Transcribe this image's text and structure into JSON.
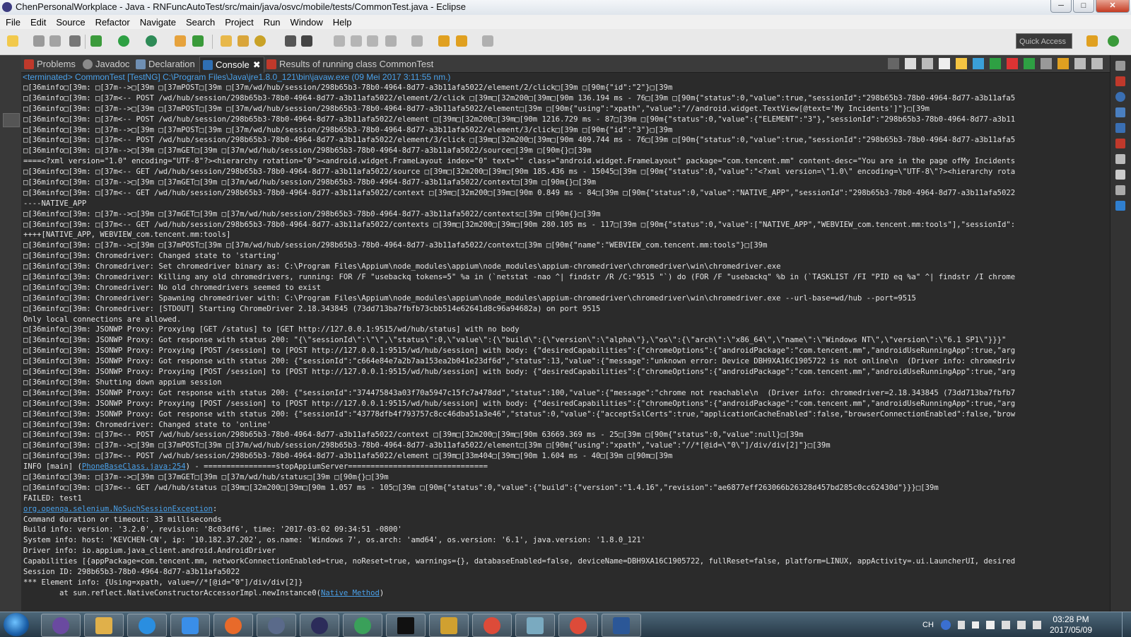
{
  "window": {
    "title": "ChenPersonalWorkplace - Java - RNFuncAutoTest/src/main/java/osvc/mobile/tests/CommonTest.java - Eclipse",
    "controls": [
      "─",
      "□",
      "✕"
    ]
  },
  "menu": [
    "File",
    "Edit",
    "Source",
    "Refactor",
    "Navigate",
    "Search",
    "Project",
    "Run",
    "Window",
    "Help"
  ],
  "toolbar": {
    "quick_access_placeholder": "Quick Access"
  },
  "tabs": [
    {
      "label": "Problems",
      "icon": "problems-icon"
    },
    {
      "label": "Javadoc",
      "icon": "javadoc-icon"
    },
    {
      "label": "Declaration",
      "icon": "declaration-icon"
    },
    {
      "label": "Console",
      "icon": "console-icon",
      "active": true
    },
    {
      "label": "Results of running class CommonTest",
      "icon": "testng-icon"
    }
  ],
  "console": {
    "status": "<terminated> CommonTest [TestNG] C:\\Program Files\\Java\\jre1.8.0_121\\bin\\javaw.exe (09 Mei 2017 3:11:55 nm.)",
    "lines": [
      {
        "text": "□[36minfo□[39m: □[37m-->□[39m □[37mPOST□[39m □[37m/wd/hub/session/298b65b3-78b0-4964-8d77-a3b11afa5022/element/2/click□[39m □[90m{\"id\":\"2\"}□[39m"
      },
      {
        "text": "□[36minfo□[39m: □[37m<-- POST /wd/hub/session/298b65b3-78b0-4964-8d77-a3b11afa5022/element/2/click □[39m□[32m200□[39m□[90m 136.194 ms - 76□[39m □[90m{\"status\":0,\"value\":true,\"sessionId\":\"298b65b3-78b0-4964-8d77-a3b11afa5"
      },
      {
        "text": "□[36minfo□[39m: □[37m-->□[39m □[37mPOST□[39m □[37m/wd/hub/session/298b65b3-78b0-4964-8d77-a3b11afa5022/element□[39m □[90m{\"using\":\"xpath\",\"value\":\"//android.widget.TextView[@text='My Incidents']\"}□[39m"
      },
      {
        "text": "□[36minfo□[39m: □[37m<-- POST /wd/hub/session/298b65b3-78b0-4964-8d77-a3b11afa5022/element □[39m□[32m200□[39m□[90m 1216.729 ms - 87□[39m □[90m{\"status\":0,\"value\":{\"ELEMENT\":\"3\"},\"sessionId\":\"298b65b3-78b0-4964-8d77-a3b11"
      },
      {
        "text": "□[36minfo□[39m: □[37m-->□[39m □[37mPOST□[39m □[37m/wd/hub/session/298b65b3-78b0-4964-8d77-a3b11afa5022/element/3/click□[39m □[90m{\"id\":\"3\"}□[39m"
      },
      {
        "text": "□[36minfo□[39m: □[37m<-- POST /wd/hub/session/298b65b3-78b0-4964-8d77-a3b11afa5022/element/3/click □[39m□[32m200□[39m□[90m 409.744 ms - 76□[39m □[90m{\"status\":0,\"value\":true,\"sessionId\":\"298b65b3-78b0-4964-8d77-a3b11afa5"
      },
      {
        "text": "□[36minfo□[39m: □[37m-->□[39m □[37mGET□[39m □[37m/wd/hub/session/298b65b3-78b0-4964-8d77-a3b11afa5022/source□[39m □[90m{}□[39m"
      },
      {
        "text": "====<?xml version=\"1.0\" encoding=\"UTF-8\"?><hierarchy rotation=\"0\"><android.widget.FrameLayout index=\"0\" text=\"\" class=\"android.widget.FrameLayout\" package=\"com.tencent.mm\" content-desc=\"You are in the page ofMy Incidents"
      },
      {
        "text": "□[36minfo□[39m: □[37m<-- GET /wd/hub/session/298b65b3-78b0-4964-8d77-a3b11afa5022/source □[39m□[32m200□[39m□[90m 185.436 ms - 15045□[39m □[90m{\"status\":0,\"value\":\"<?xml version=\\\"1.0\\\" encoding=\\\"UTF-8\\\"?><hierarchy rota"
      },
      {
        "text": "□[36minfo□[39m: □[37m-->□[39m □[37mGET□[39m □[37m/wd/hub/session/298b65b3-78b0-4964-8d77-a3b11afa5022/context□[39m □[90m{}□[39m"
      },
      {
        "text": "□[36minfo□[39m: □[37m<-- GET /wd/hub/session/298b65b3-78b0-4964-8d77-a3b11afa5022/context □[39m□[32m200□[39m□[90m 0.849 ms - 84□[39m □[90m{\"status\":0,\"value\":\"NATIVE_APP\",\"sessionId\":\"298b65b3-78b0-4964-8d77-a3b11afa5022"
      },
      {
        "text": "----NATIVE_APP"
      },
      {
        "text": "□[36minfo□[39m: □[37m-->□[39m □[37mGET□[39m □[37m/wd/hub/session/298b65b3-78b0-4964-8d77-a3b11afa5022/contexts□[39m □[90m{}□[39m"
      },
      {
        "text": "□[36minfo□[39m: □[37m<-- GET /wd/hub/session/298b65b3-78b0-4964-8d77-a3b11afa5022/contexts □[39m□[32m200□[39m□[90m 280.105 ms - 117□[39m □[90m{\"status\":0,\"value\":[\"NATIVE_APP\",\"WEBVIEW_com.tencent.mm:tools\"],\"sessionId\":"
      },
      {
        "text": "++++[NATIVE_APP, WEBVIEW_com.tencent.mm:tools]"
      },
      {
        "text": "□[36minfo□[39m: □[37m-->□[39m □[37mPOST□[39m □[37m/wd/hub/session/298b65b3-78b0-4964-8d77-a3b11afa5022/context□[39m □[90m{\"name\":\"WEBVIEW_com.tencent.mm:tools\"}□[39m"
      },
      {
        "text": "□[36minfo□[39m: Chromedriver: Changed state to 'starting'"
      },
      {
        "text": "□[36minfo□[39m: Chromedriver: Set chromedriver binary as: C:\\Program Files\\Appium\\node_modules\\appium\\node_modules\\appium-chromedriver\\chromedriver\\win\\chromedriver.exe"
      },
      {
        "text": "□[36minfo□[39m: Chromedriver: Killing any old chromedrivers, running: FOR /F \"usebackq tokens=5\" %a in (`netstat -nao ^| findstr /R /C:\"9515 \"`) do (FOR /F \"usebackq\" %b in (`TASKLIST /FI \"PID eq %a\" ^| findstr /I chrome"
      },
      {
        "text": "□[36minfo□[39m: Chromedriver: No old chromedrivers seemed to exist"
      },
      {
        "text": "□[36minfo□[39m: Chromedriver: Spawning chromedriver with: C:\\Program Files\\Appium\\node_modules\\appium\\node_modules\\appium-chromedriver\\chromedriver\\win\\chromedriver.exe --url-base=wd/hub --port=9515"
      },
      {
        "text": "□[36minfo□[39m: Chromedriver: [STDOUT] Starting ChromeDriver 2.18.343845 (73dd713ba7fbfb73cbb514e62641d8c96a94682a) on port 9515"
      },
      {
        "text": "Only local connections are allowed."
      },
      {
        "text": "□[36minfo□[39m: JSONWP Proxy: Proxying [GET /status] to [GET http://127.0.0.1:9515/wd/hub/status] with no body"
      },
      {
        "text": "□[36minfo□[39m: JSONWP Proxy: Got response with status 200: \"{\\\"sessionId\\\":\\\"\\\",\\\"status\\\":0,\\\"value\\\":{\\\"build\\\":{\\\"version\\\":\\\"alpha\\\"},\\\"os\\\":{\\\"arch\\\":\\\"x86_64\\\",\\\"name\\\":\\\"Windows NT\\\",\\\"version\\\":\\\"6.1 SP1\\\"}}}\""
      },
      {
        "text": "□[36minfo□[39m: JSONWP Proxy: Proxying [POST /session] to [POST http://127.0.0.1:9515/wd/hub/session] with body: {\"desiredCapabilities\":{\"chromeOptions\":{\"androidPackage\":\"com.tencent.mm\",\"androidUseRunningApp\":true,\"arg"
      },
      {
        "text": "□[36minfo□[39m: JSONWP Proxy: Got response with status 200: {\"sessionId\":\"c664e84e7a2b7aa153ea2b041e23df6d\",\"status\":13,\"value\":{\"message\":\"unknown error: Device DBH9XA16C1905722 is not online\\n  (Driver info: chromedriv"
      },
      {
        "text": "□[36minfo□[39m: JSONWP Proxy: Proxying [POST /session] to [POST http://127.0.0.1:9515/wd/hub/session] with body: {\"desiredCapabilities\":{\"chromeOptions\":{\"androidPackage\":\"com.tencent.mm\",\"androidUseRunningApp\":true,\"arg"
      },
      {
        "text": "□[36minfo□[39m: Shutting down appium session"
      },
      {
        "text": "□[36minfo□[39m: JSONWP Proxy: Got response with status 200: {\"sessionId\":\"374475843a03f70a5947c15fc7a478dd\",\"status\":100,\"value\":{\"message\":\"chrome not reachable\\n  (Driver info: chromedriver=2.18.343845 (73dd713ba7fbfb7"
      },
      {
        "text": "□[36minfo□[39m: JSONWP Proxy: Proxying [POST /session] to [POST http://127.0.0.1:9515/wd/hub/session] with body: {\"desiredCapabilities\":{\"chromeOptions\":{\"androidPackage\":\"com.tencent.mm\",\"androidUseRunningApp\":true,\"arg"
      },
      {
        "text": "□[36minfo□[39m: JSONWP Proxy: Got response with status 200: {\"sessionId\":\"43778dfb4f793757c8cc46dba51a3e46\",\"status\":0,\"value\":{\"acceptSslCerts\":true,\"applicationCacheEnabled\":false,\"browserConnectionEnabled\":false,\"brow"
      },
      {
        "text": "□[36minfo□[39m: Chromedriver: Changed state to 'online'"
      },
      {
        "text": "□[36minfo□[39m: □[37m<-- POST /wd/hub/session/298b65b3-78b0-4964-8d77-a3b11afa5022/context □[39m□[32m200□[39m□[90m 63669.369 ms - 25□[39m □[90m{\"status\":0,\"value\":null}□[39m"
      },
      {
        "text": "□[36minfo□[39m: □[37m-->□[39m □[37mPOST□[39m □[37m/wd/hub/session/298b65b3-78b0-4964-8d77-a3b11afa5022/element□[39m □[90m{\"using\":\"xpath\",\"value\":\"//*[@id=\\\"0\\\"]/div/div[2]\"}□[39m"
      },
      {
        "text": "□[36minfo□[39m: □[37m<-- POST /wd/hub/session/298b65b3-78b0-4964-8d77-a3b11afa5022/element □[39m□[33m404□[39m□[90m 1.604 ms - 40□[39m □[90m□[39m"
      },
      {
        "pre": "INFO [main] (",
        "link": "PhoneBaseClass.java:254",
        "post": ") - ================stopAppiumServer==============================="
      },
      {
        "text": "□[36minfo□[39m: □[37m-->□[39m □[37mGET□[39m □[37m/wd/hub/status□[39m □[90m{}□[39m"
      },
      {
        "text": "□[36minfo□[39m: □[37m<-- GET /wd/hub/status □[39m□[32m200□[39m□[90m 1.057 ms - 105□[39m □[90m{\"status\":0,\"value\":{\"build\":{\"version\":\"1.4.16\",\"revision\":\"ae6877eff263066b26328d457bd285c0cc62430d\"}}}□[39m"
      },
      {
        "text": "FAILED: test1"
      },
      {
        "pre": "",
        "link": "org.openqa.selenium.NoSuchSessionException",
        "post": ":"
      },
      {
        "text": "Command duration or timeout: 33 milliseconds"
      },
      {
        "text": "Build info: version: '3.2.0', revision: '8c03df6', time: '2017-03-02 09:34:51 -0800'"
      },
      {
        "text": "System info: host: 'KEVCHEN-CN', ip: '10.182.37.202', os.name: 'Windows 7', os.arch: 'amd64', os.version: '6.1', java.version: '1.8.0_121'"
      },
      {
        "text": "Driver info: io.appium.java_client.android.AndroidDriver"
      },
      {
        "text": "Capabilities [{appPackage=com.tencent.mm, networkConnectionEnabled=true, noReset=true, warnings={}, databaseEnabled=false, deviceName=DBH9XA16C1905722, fullReset=false, platform=LINUX, appActivity=.ui.LauncherUI, desired"
      },
      {
        "text": "Session ID: 298b65b3-78b0-4964-8d77-a3b11afa5022"
      },
      {
        "text": "*** Element info: {Using=xpath, value=//*[@id=\"0\"]/div/div[2]}"
      },
      {
        "pre": "        at sun.reflect.NativeConstructorAccessorImpl.newInstance0(",
        "link": "Native Method",
        "post": ")"
      }
    ]
  },
  "tray": {
    "lang": "CH",
    "time": "03:28 PM",
    "date": "2017/05/09"
  }
}
